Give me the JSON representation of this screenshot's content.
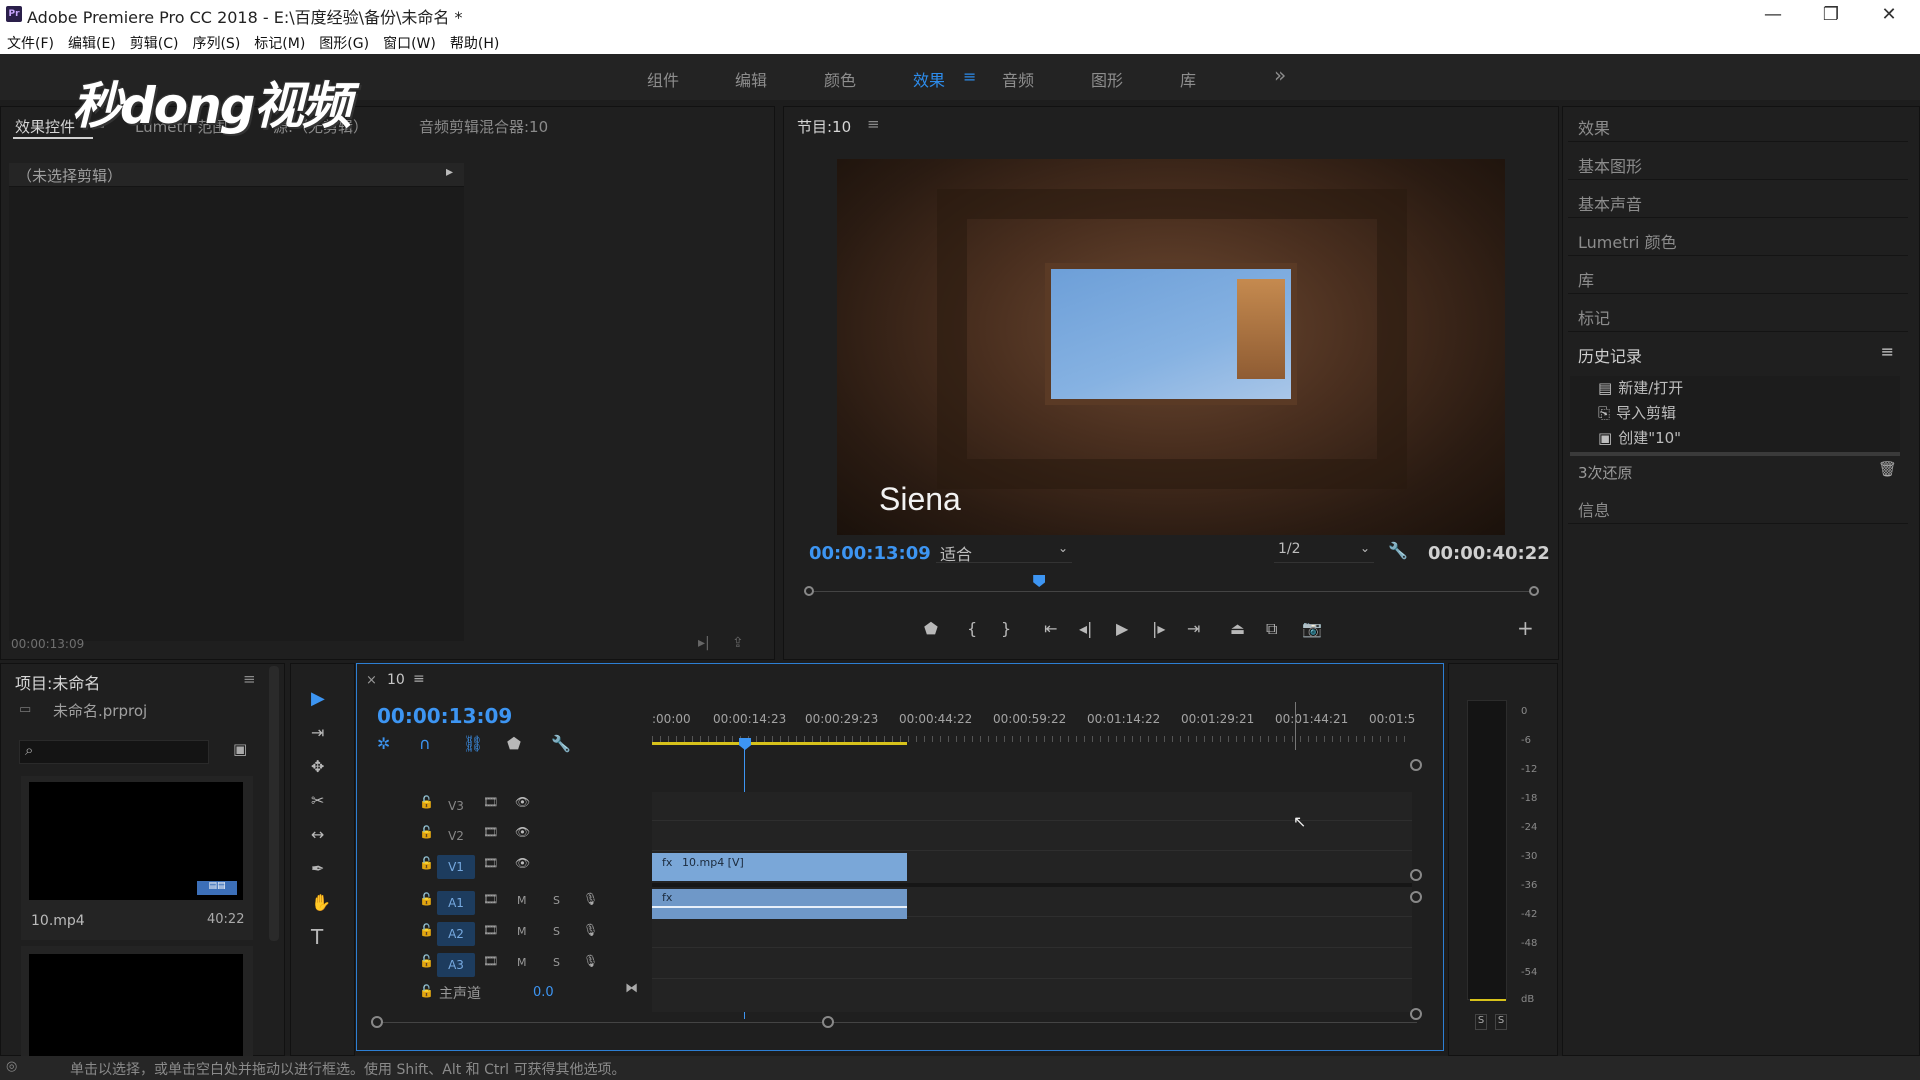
{
  "window": {
    "title": "Adobe Premiere Pro CC 2018 - E:\\百度经验\\备份\\未命名 *",
    "app_icon": "Pr",
    "minimize_icon": "—",
    "restore_icon": "❐",
    "close_icon": "✕"
  },
  "menu": [
    "文件(F)",
    "编辑(E)",
    "剪辑(C)",
    "序列(S)",
    "标记(M)",
    "图形(G)",
    "窗口(W)",
    "帮助(H)"
  ],
  "workspaces": {
    "tabs": [
      "组件",
      "编辑",
      "颜色",
      "效果",
      "音频",
      "图形",
      "库"
    ],
    "active": "效果",
    "menu_icon": "≡",
    "more_icon": "»"
  },
  "watermark": "秒dong视频",
  "source_panel": {
    "tabs": [
      "效果控件",
      "Lumetri 范围",
      "源:（无剪辑）",
      "音频剪辑混合器:10"
    ],
    "menu_icon": "≡",
    "no_clip": "（未选择剪辑）",
    "arrow_icon": "▸",
    "timecode": "00:00:13:09"
  },
  "program": {
    "title": "节目:10",
    "menu_icon": "≡",
    "overlay_text": "Siena",
    "timecode": "00:00:13:09",
    "fit": "适合",
    "resolution": "1/2",
    "duration": "00:00:40:22",
    "playhead_fraction": 0.32
  },
  "right_panels": {
    "items_top": [
      "效果",
      "基本图形",
      "基本声音",
      "Lumetri 颜色",
      "库",
      "标记"
    ],
    "history_title": "历史记录",
    "history_menu_icon": "≡",
    "history_items": [
      "新建/打开",
      "导入剪辑",
      "创建\"10\""
    ],
    "undo_text": "3次还原",
    "trash_icon": "🗑",
    "info": "信息"
  },
  "project": {
    "title": "项目:未命名",
    "menu_icon": "≡",
    "file": "未命名.prproj",
    "search_icon": "⌕",
    "bin_icon": "▣",
    "clip_name": "10.mp4",
    "clip_duration": "40:22"
  },
  "tools": {
    "selection_icon": "▶",
    "track_select_icon": "⇥",
    "ripple_icon": "✥",
    "razor_icon": "✂",
    "slip_icon": "↔",
    "pen_icon": "✒",
    "hand_icon": "✋",
    "type_icon": "T"
  },
  "timeline": {
    "close_icon": "×",
    "name": "10",
    "menu_icon": "≡",
    "timecode": "00:00:13:09",
    "ruler": [
      ":00:00",
      "00:00:14:23",
      "00:00:29:23",
      "00:00:44:22",
      "00:00:59:22",
      "00:01:14:22",
      "00:01:29:21",
      "00:01:44:21",
      "00:01:5"
    ],
    "video_tracks": [
      "V3",
      "V2",
      "V1"
    ],
    "audio_tracks": [
      "A1",
      "A2",
      "A3"
    ],
    "mute": "M",
    "solo": "S",
    "master": "主声道",
    "master_value": "0.0",
    "video_clip": "10.mp4 [V]",
    "lock_icon": "🔓",
    "eye_icon": "👁",
    "mic_icon": "🎙",
    "film_icon": "🎞"
  },
  "meter": {
    "scale": [
      "0",
      "-6",
      "-12",
      "-18",
      "-24",
      "-30",
      "-36",
      "-42",
      "-48",
      "-54",
      "dB"
    ],
    "solo_left": "S",
    "solo_right": "S"
  },
  "status": "单击以选择，或单击空白处并拖动以进行框选。使用 Shift、Alt 和 Ctrl 可获得其他选项。"
}
